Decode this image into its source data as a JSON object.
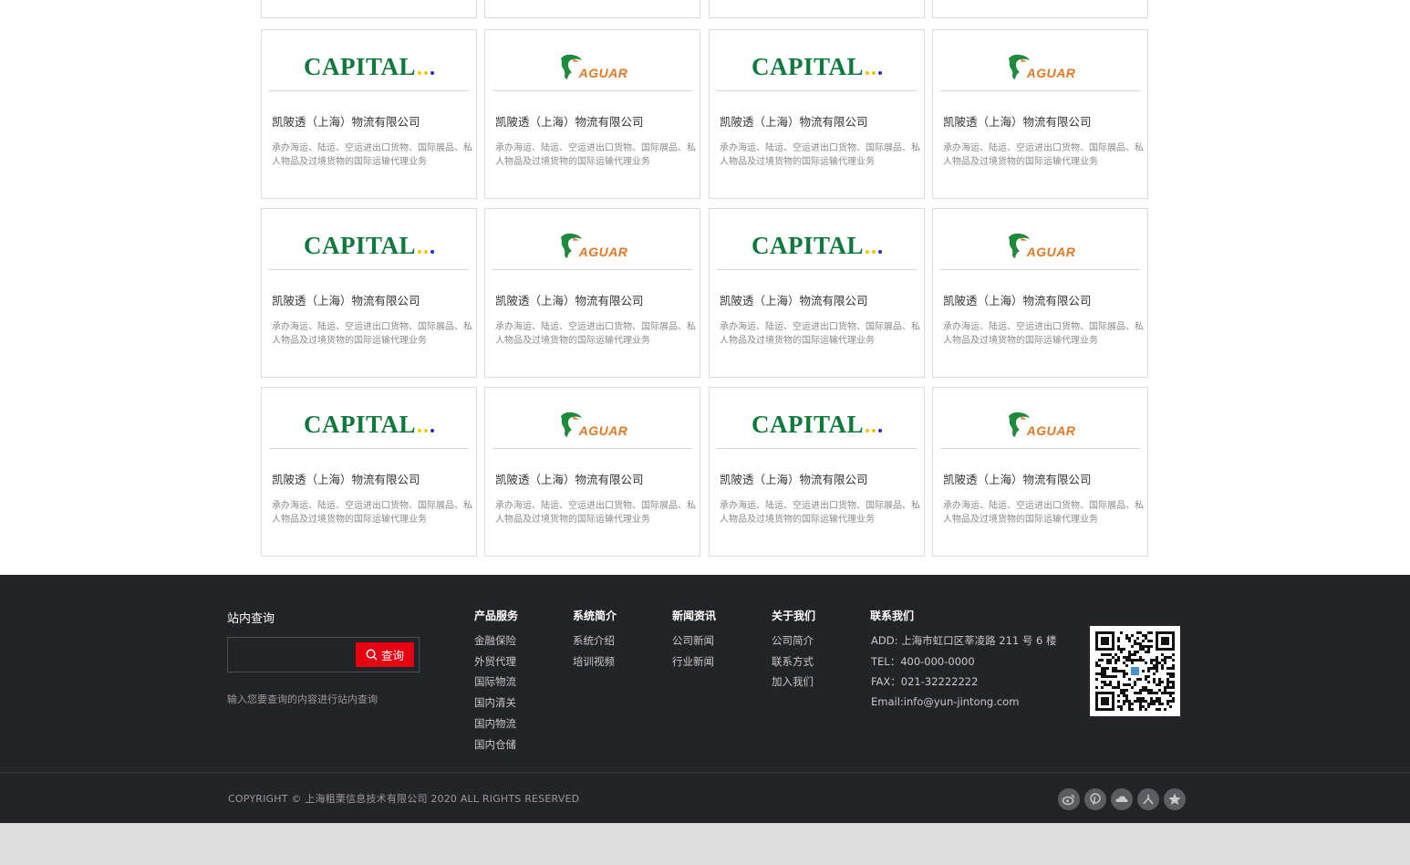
{
  "colors": {
    "capital_green": "#0c7a3a",
    "jaguar_orange": "#e7771f",
    "footer_bg": "#222428",
    "search_red": "#e60012"
  },
  "cards": [
    {
      "logo": "capital",
      "logo_text": "CAPITAL",
      "name": "凯陂透（上海）物流有限公司",
      "desc": "承办海运、陆运、空运进出口货物、国际展品、私人物品及过境货物的国际运输代理业务"
    },
    {
      "logo": "jaguar",
      "logo_text": "AGUAR",
      "name": "凯陂透（上海）物流有限公司",
      "desc": "承办海运、陆运、空运进出口货物、国际展品、私人物品及过境货物的国际运输代理业务"
    },
    {
      "logo": "capital",
      "logo_text": "CAPITAL",
      "name": "凯陂透（上海）物流有限公司",
      "desc": "承办海运、陆运、空运进出口货物、国际展品、私人物品及过境货物的国际运输代理业务"
    },
    {
      "logo": "jaguar",
      "logo_text": "AGUAR",
      "name": "凯陂透（上海）物流有限公司",
      "desc": "承办海运、陆运、空运进出口货物、国际展品、私人物品及过境货物的国际运输代理业务"
    },
    {
      "logo": "capital",
      "logo_text": "CAPITAL",
      "name": "凯陂透（上海）物流有限公司",
      "desc": "承办海运、陆运、空运进出口货物、国际展品、私人物品及过境货物的国际运输代理业务"
    },
    {
      "logo": "jaguar",
      "logo_text": "AGUAR",
      "name": "凯陂透（上海）物流有限公司",
      "desc": "承办海运、陆运、空运进出口货物、国际展品、私人物品及过境货物的国际运输代理业务"
    },
    {
      "logo": "capital",
      "logo_text": "CAPITAL",
      "name": "凯陂透（上海）物流有限公司",
      "desc": "承办海运、陆运、空运进出口货物、国际展品、私人物品及过境货物的国际运输代理业务"
    },
    {
      "logo": "jaguar",
      "logo_text": "AGUAR",
      "name": "凯陂透（上海）物流有限公司",
      "desc": "承办海运、陆运、空运进出口货物、国际展品、私人物品及过境货物的国际运输代理业务"
    },
    {
      "logo": "capital",
      "logo_text": "CAPITAL",
      "name": "凯陂透（上海）物流有限公司",
      "desc": "承办海运、陆运、空运进出口货物、国际展品、私人物品及过境货物的国际运输代理业务"
    },
    {
      "logo": "jaguar",
      "logo_text": "AGUAR",
      "name": "凯陂透（上海）物流有限公司",
      "desc": "承办海运、陆运、空运进出口货物、国际展品、私人物品及过境货物的国际运输代理业务"
    },
    {
      "logo": "capital",
      "logo_text": "CAPITAL",
      "name": "凯陂透（上海）物流有限公司",
      "desc": "承办海运、陆运、空运进出口货物、国际展品、私人物品及过境货物的国际运输代理业务"
    },
    {
      "logo": "jaguar",
      "logo_text": "AGUAR",
      "name": "凯陂透（上海）物流有限公司",
      "desc": "承办海运、陆运、空运进出口货物、国际展品、私人物品及过境货物的国际运输代理业务"
    }
  ],
  "footer": {
    "search": {
      "title": "站内查询",
      "placeholder": "",
      "button": "查询",
      "hint": "输入您要查询的内容进行站内查询"
    },
    "columns": [
      {
        "title": "产品服务",
        "links": [
          "金融保险",
          "外贸代理",
          "国际物流",
          "国内清关",
          "国内物流",
          "国内仓储"
        ]
      },
      {
        "title": "系统简介",
        "links": [
          "系统介绍",
          "培训视频"
        ]
      },
      {
        "title": "新闻资讯",
        "links": [
          "公司新闻",
          "行业新闻"
        ]
      },
      {
        "title": "关于我们",
        "links": [
          "公司简介",
          "联系方式",
          "加入我们"
        ]
      }
    ],
    "contact": {
      "title": "联系我们",
      "lines": [
        "ADD: 上海市虹口区莘凌路 211 号 6 楼",
        "TEL：400-000-0000",
        "FAX：021-32222222",
        "Email:info@yun-jintong.com"
      ]
    },
    "copyright": "COPYRIGHT  ©  上海粗栗信息技术有限公司  2020    ALL RIGHTS RESERVED",
    "social_icons": [
      "weibo-icon",
      "pinterest-icon",
      "cloud-icon",
      "renren-icon",
      "star-icon"
    ]
  }
}
